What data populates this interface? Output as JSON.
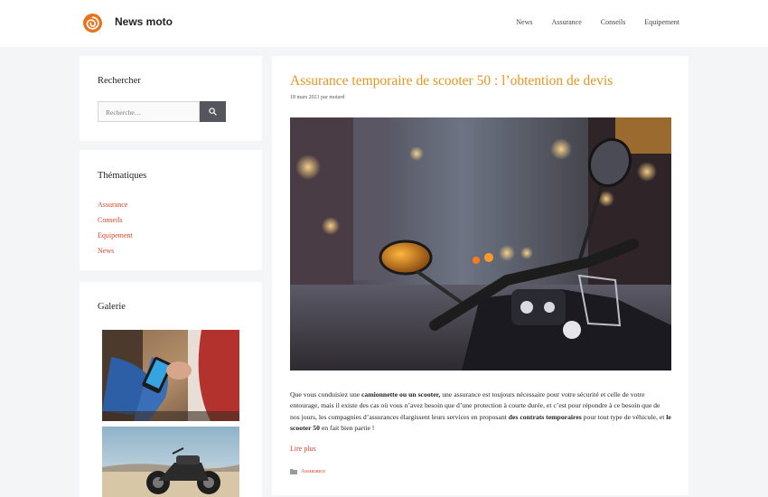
{
  "header": {
    "site_title": "News moto",
    "nav": [
      "News",
      "Assurance",
      "Conseils",
      "Equipement"
    ]
  },
  "sidebar": {
    "search": {
      "title": "Rechercher",
      "placeholder": "Recherche…"
    },
    "themes": {
      "title": "Thématiques",
      "items": [
        "Assurance",
        "Conseils",
        "Equipement",
        "News"
      ]
    },
    "gallery": {
      "title": "Galerie"
    }
  },
  "article": {
    "title": "Assurance temporaire de scooter 50 : l’obtention de devis",
    "meta": "18 mars 2021 par motard",
    "excerpt": {
      "p1": "Que vous conduisiez une ",
      "b1": "camionnette ou un scooter,",
      "p2": " une assurance est toujours nécessaire pour votre sécurité et celle de votre entourage, mais il existe des cas où vous n’avez besoin que d’une protection à courte durée, et c’est pour répondre à ce besoin que de nos jours, les compagnies d’assurances élargissent leurs services en proposant ",
      "b2": "des contrats temporaires",
      "p3": " pour tout type de véhicule, et ",
      "b3": "le scooter 50",
      "p4": " en fait bien partie !"
    },
    "read_more": "Lire plus",
    "category": "Assurance"
  },
  "colors": {
    "accent_link": "#d9442b",
    "title_orange": "#e8941e",
    "search_button": "#55555e"
  }
}
